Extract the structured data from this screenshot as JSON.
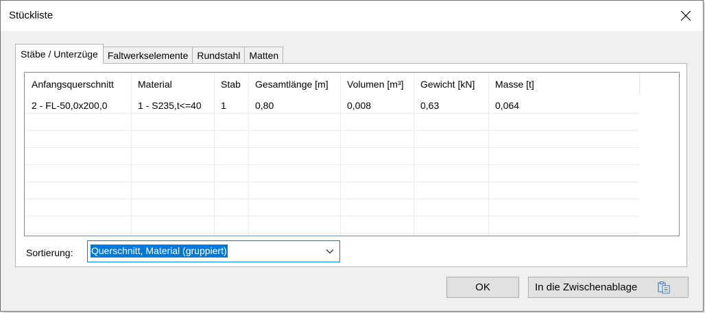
{
  "window": {
    "title": "Stückliste"
  },
  "tabs": [
    {
      "label": "Stäbe / Unterzüge",
      "active": true
    },
    {
      "label": "Faltwerkselemente",
      "active": false
    },
    {
      "label": "Rundstahl",
      "active": false
    },
    {
      "label": "Matten",
      "active": false
    }
  ],
  "table": {
    "columns": [
      "Anfangsquerschnitt",
      "Material",
      "Stab",
      "Gesamtlänge [m]",
      "Volumen [m³]",
      "Gewicht [kN]",
      "Masse [t]"
    ],
    "rows": [
      [
        "2 - FL-50,0x200,0",
        "1 - S235,t<=40",
        "1",
        "0,80",
        "0,008",
        "0,63",
        "0,064"
      ]
    ]
  },
  "sort": {
    "label": "Sortierung:",
    "value": "Querschnitt, Material (gruppiert)"
  },
  "buttons": {
    "ok": "OK",
    "clipboard": "In die Zwischenablage"
  },
  "icons": {
    "close": "close-icon",
    "dropdown": "chevron-down-icon",
    "clipboard": "clipboard-copy-icon"
  },
  "colors": {
    "accent": "#0078d7",
    "dialog_bg": "#f0f0f0",
    "button_bg": "#e1e1e1"
  }
}
